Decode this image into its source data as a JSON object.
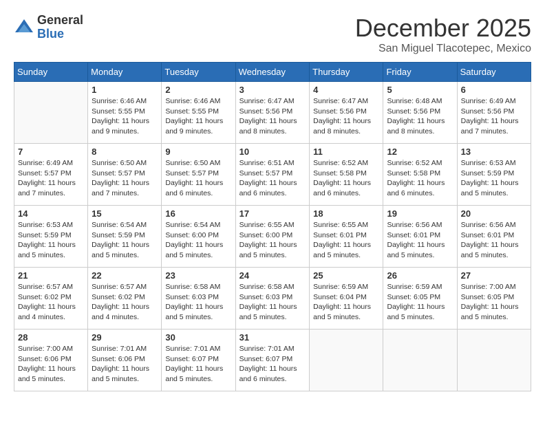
{
  "logo": {
    "general": "General",
    "blue": "Blue"
  },
  "title": {
    "month": "December 2025",
    "location": "San Miguel Tlacotepec, Mexico"
  },
  "days_of_week": [
    "Sunday",
    "Monday",
    "Tuesday",
    "Wednesday",
    "Thursday",
    "Friday",
    "Saturday"
  ],
  "weeks": [
    [
      {
        "num": "",
        "info": ""
      },
      {
        "num": "1",
        "info": "Sunrise: 6:46 AM\nSunset: 5:55 PM\nDaylight: 11 hours\nand 9 minutes."
      },
      {
        "num": "2",
        "info": "Sunrise: 6:46 AM\nSunset: 5:55 PM\nDaylight: 11 hours\nand 9 minutes."
      },
      {
        "num": "3",
        "info": "Sunrise: 6:47 AM\nSunset: 5:56 PM\nDaylight: 11 hours\nand 8 minutes."
      },
      {
        "num": "4",
        "info": "Sunrise: 6:47 AM\nSunset: 5:56 PM\nDaylight: 11 hours\nand 8 minutes."
      },
      {
        "num": "5",
        "info": "Sunrise: 6:48 AM\nSunset: 5:56 PM\nDaylight: 11 hours\nand 8 minutes."
      },
      {
        "num": "6",
        "info": "Sunrise: 6:49 AM\nSunset: 5:56 PM\nDaylight: 11 hours\nand 7 minutes."
      }
    ],
    [
      {
        "num": "7",
        "info": "Sunrise: 6:49 AM\nSunset: 5:57 PM\nDaylight: 11 hours\nand 7 minutes."
      },
      {
        "num": "8",
        "info": "Sunrise: 6:50 AM\nSunset: 5:57 PM\nDaylight: 11 hours\nand 7 minutes."
      },
      {
        "num": "9",
        "info": "Sunrise: 6:50 AM\nSunset: 5:57 PM\nDaylight: 11 hours\nand 6 minutes."
      },
      {
        "num": "10",
        "info": "Sunrise: 6:51 AM\nSunset: 5:57 PM\nDaylight: 11 hours\nand 6 minutes."
      },
      {
        "num": "11",
        "info": "Sunrise: 6:52 AM\nSunset: 5:58 PM\nDaylight: 11 hours\nand 6 minutes."
      },
      {
        "num": "12",
        "info": "Sunrise: 6:52 AM\nSunset: 5:58 PM\nDaylight: 11 hours\nand 6 minutes."
      },
      {
        "num": "13",
        "info": "Sunrise: 6:53 AM\nSunset: 5:59 PM\nDaylight: 11 hours\nand 5 minutes."
      }
    ],
    [
      {
        "num": "14",
        "info": "Sunrise: 6:53 AM\nSunset: 5:59 PM\nDaylight: 11 hours\nand 5 minutes."
      },
      {
        "num": "15",
        "info": "Sunrise: 6:54 AM\nSunset: 5:59 PM\nDaylight: 11 hours\nand 5 minutes."
      },
      {
        "num": "16",
        "info": "Sunrise: 6:54 AM\nSunset: 6:00 PM\nDaylight: 11 hours\nand 5 minutes."
      },
      {
        "num": "17",
        "info": "Sunrise: 6:55 AM\nSunset: 6:00 PM\nDaylight: 11 hours\nand 5 minutes."
      },
      {
        "num": "18",
        "info": "Sunrise: 6:55 AM\nSunset: 6:01 PM\nDaylight: 11 hours\nand 5 minutes."
      },
      {
        "num": "19",
        "info": "Sunrise: 6:56 AM\nSunset: 6:01 PM\nDaylight: 11 hours\nand 5 minutes."
      },
      {
        "num": "20",
        "info": "Sunrise: 6:56 AM\nSunset: 6:01 PM\nDaylight: 11 hours\nand 5 minutes."
      }
    ],
    [
      {
        "num": "21",
        "info": "Sunrise: 6:57 AM\nSunset: 6:02 PM\nDaylight: 11 hours\nand 4 minutes."
      },
      {
        "num": "22",
        "info": "Sunrise: 6:57 AM\nSunset: 6:02 PM\nDaylight: 11 hours\nand 4 minutes."
      },
      {
        "num": "23",
        "info": "Sunrise: 6:58 AM\nSunset: 6:03 PM\nDaylight: 11 hours\nand 5 minutes."
      },
      {
        "num": "24",
        "info": "Sunrise: 6:58 AM\nSunset: 6:03 PM\nDaylight: 11 hours\nand 5 minutes."
      },
      {
        "num": "25",
        "info": "Sunrise: 6:59 AM\nSunset: 6:04 PM\nDaylight: 11 hours\nand 5 minutes."
      },
      {
        "num": "26",
        "info": "Sunrise: 6:59 AM\nSunset: 6:05 PM\nDaylight: 11 hours\nand 5 minutes."
      },
      {
        "num": "27",
        "info": "Sunrise: 7:00 AM\nSunset: 6:05 PM\nDaylight: 11 hours\nand 5 minutes."
      }
    ],
    [
      {
        "num": "28",
        "info": "Sunrise: 7:00 AM\nSunset: 6:06 PM\nDaylight: 11 hours\nand 5 minutes."
      },
      {
        "num": "29",
        "info": "Sunrise: 7:01 AM\nSunset: 6:06 PM\nDaylight: 11 hours\nand 5 minutes."
      },
      {
        "num": "30",
        "info": "Sunrise: 7:01 AM\nSunset: 6:07 PM\nDaylight: 11 hours\nand 5 minutes."
      },
      {
        "num": "31",
        "info": "Sunrise: 7:01 AM\nSunset: 6:07 PM\nDaylight: 11 hours\nand 6 minutes."
      },
      {
        "num": "",
        "info": ""
      },
      {
        "num": "",
        "info": ""
      },
      {
        "num": "",
        "info": ""
      }
    ]
  ]
}
